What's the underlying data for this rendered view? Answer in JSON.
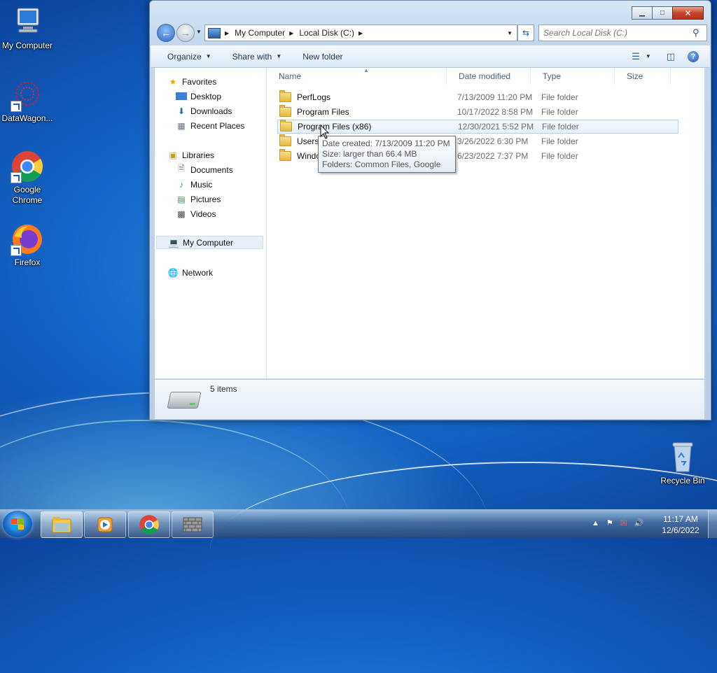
{
  "desktop": {
    "icons": [
      {
        "label": "My Computer"
      },
      {
        "label": "DataWagon..."
      },
      {
        "label": "Google Chrome"
      },
      {
        "label": "Firefox"
      },
      {
        "label": "Recycle Bin"
      }
    ]
  },
  "window": {
    "caption": {
      "minimize": "▁",
      "maximize": "□",
      "close": "✕"
    },
    "address": {
      "crumbs": [
        "My Computer",
        "Local Disk (C:)"
      ]
    },
    "search": {
      "placeholder": "Search Local Disk (C:)"
    },
    "toolbar": {
      "organize": "Organize",
      "share_with": "Share with",
      "new_folder": "New folder",
      "help": "?"
    },
    "nav": {
      "favorites": "Favorites",
      "desktop": "Desktop",
      "downloads": "Downloads",
      "recent_places": "Recent Places",
      "libraries": "Libraries",
      "documents": "Documents",
      "music": "Music",
      "pictures": "Pictures",
      "videos": "Videos",
      "my_computer": "My Computer",
      "network": "Network"
    },
    "columns": {
      "name": "Name",
      "date": "Date modified",
      "type": "Type",
      "size": "Size"
    },
    "files": [
      {
        "name": "PerfLogs",
        "date": "7/13/2009 11:20 PM",
        "type": "File folder"
      },
      {
        "name": "Program Files",
        "date": "10/17/2022 8:58 PM",
        "type": "File folder"
      },
      {
        "name": "Program Files (x86)",
        "date": "12/30/2021 5:52 PM",
        "type": "File folder"
      },
      {
        "name": "Users",
        "date": "3/26/2022 6:30 PM",
        "type": "File folder"
      },
      {
        "name": "Windows",
        "date": "6/23/2022 7:37 PM",
        "type": "File folder"
      }
    ],
    "tooltip": {
      "line1": "Date created: 7/13/2009 11:20 PM",
      "line2": "Size: larger than 66.4 MB",
      "line3": "Folders: Common Files, Google"
    },
    "status": {
      "items": "5 items"
    }
  },
  "taskbar": {
    "clock_time": "11:17 AM",
    "clock_date": "12/6/2022"
  },
  "colors": {
    "accent": "#1a5fd0",
    "selection": "#e6f0fb"
  }
}
